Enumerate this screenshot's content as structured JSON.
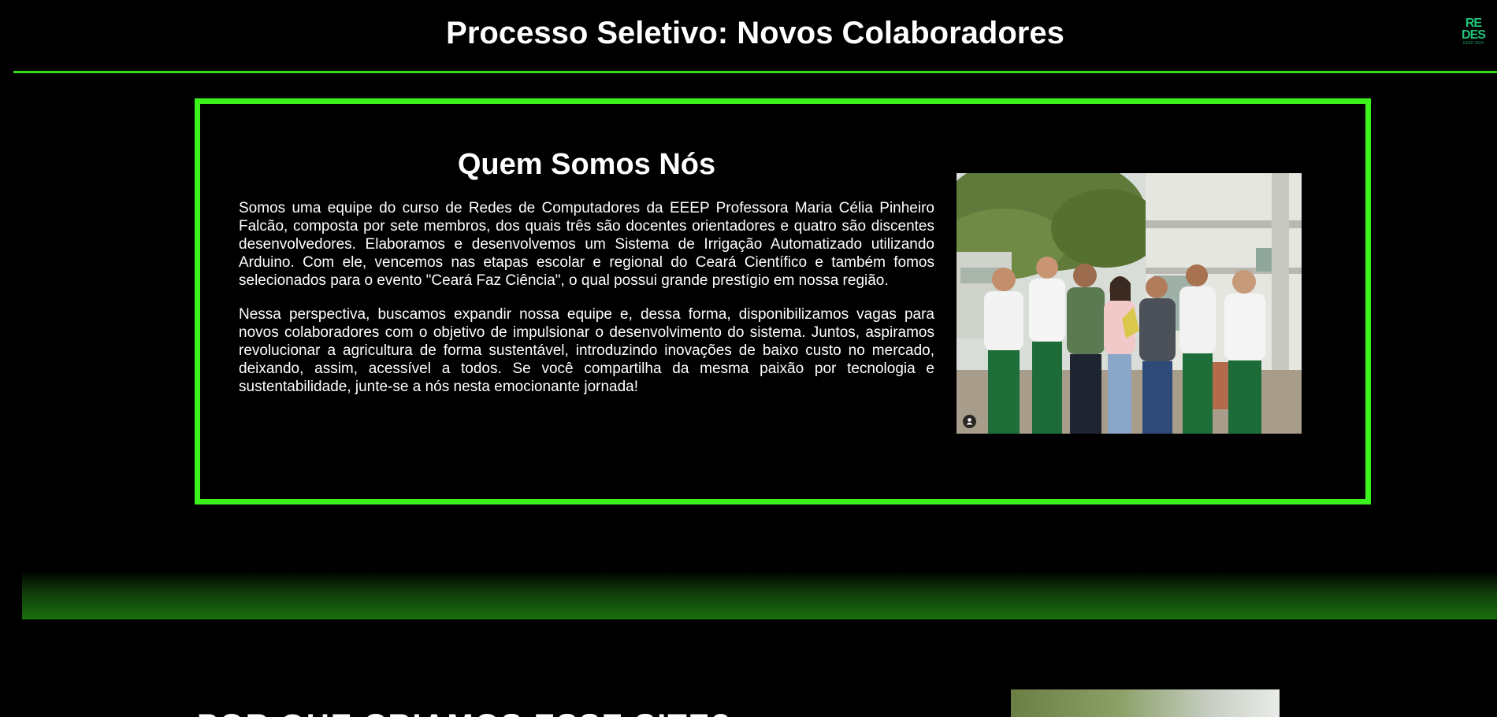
{
  "header": {
    "title": "Processo Seletivo: Novos Colaboradores",
    "logo": {
      "line1": "RE",
      "line2": "DES",
      "sub": "EEEP 2024"
    }
  },
  "about": {
    "title": "Quem Somos Nós",
    "paragraphs": [
      "Somos uma equipe do curso de Redes de Computadores da EEEP Professora Maria Célia Pinheiro Falcão, composta por sete membros, dos quais três são docentes orientadores e quatro são discentes desenvolvedores. Elaboramos e desenvolvemos um Sistema de Irrigação Automatizado utilizando Arduino. Com ele, vencemos nas etapas escolar e regional do Ceará Científico e também fomos selecionados para o evento \"Ceará Faz Ciência\", o qual possui grande prestígio em nossa região.",
      "Nessa perspectiva, buscamos expandir nossa equipe e, dessa forma, disponibilizamos vagas para novos colaboradores com o objetivo de impulsionar o desenvolvimento do sistema. Juntos, aspiramos revolucionar a agricultura de forma sustentável, introduzindo inovações de baixo custo no mercado, deixando, assim, acessível a todos. Se você compartilha da mesma paixão por tecnologia e sustentabilidade, junte-se a nós nesta emocionante jornada!"
    ],
    "photo_icon": "user-icon"
  },
  "next_section": {
    "title": "POR QUE CRIAMOS ESSE SITE?"
  },
  "colors": {
    "accent": "#3bf21d",
    "header_line": "#3bdc1f",
    "logo": "#1fc57a",
    "background": "#000000",
    "text": "#ffffff"
  }
}
